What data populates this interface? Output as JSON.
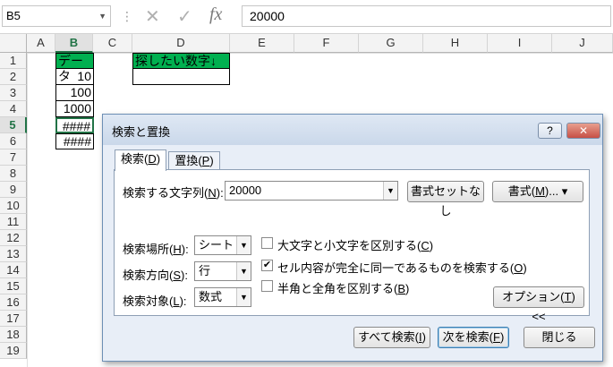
{
  "formula_bar": {
    "name_box": "B5",
    "fx_label": "fx",
    "formula_value": "20000"
  },
  "grid": {
    "columns": [
      "A",
      "B",
      "C",
      "D",
      "E",
      "F",
      "G",
      "H",
      "I",
      "J"
    ],
    "rows": [
      "1",
      "2",
      "3",
      "4",
      "5",
      "6",
      "7",
      "8",
      "9",
      "10",
      "11",
      "12",
      "13",
      "14",
      "15",
      "16",
      "17",
      "18",
      "19"
    ],
    "selected_column": "B",
    "selected_row": "5",
    "cells": {
      "B1": "データ",
      "B2": "10",
      "B3": "100",
      "B4": "1000",
      "B5": "####",
      "B6": "####",
      "D1": "探したい数字↓"
    },
    "header_fill": "#00b050"
  },
  "dialog": {
    "title": "検索と置換",
    "help_label": "?",
    "close_label": "✕",
    "tabs": [
      {
        "label": "検索",
        "key": "D",
        "active": true
      },
      {
        "label": "置換",
        "key": "P",
        "active": false
      }
    ],
    "find_label": "検索する文字列(",
    "find_key": "N",
    "find_label_end": "):",
    "find_value": "20000",
    "no_format_label": "書式セットなし",
    "format_label": "書式(",
    "format_key": "M",
    "format_label_end": ")...",
    "within_label": "検索場所(",
    "within_key": "H",
    "within_value": "シート",
    "search_label": "検索方向(",
    "search_key": "S",
    "search_value": "行",
    "lookin_label": "検索対象(",
    "lookin_key": "L",
    "lookin_value": "数式",
    "match_case_label": "大文字と小文字を区別する(",
    "match_case_key": "C",
    "match_case_checked": false,
    "match_entire_label": "セル内容が完全に同一であるものを検索する(",
    "match_entire_key": "O",
    "match_entire_checked": true,
    "match_byte_label": "半角と全角を区別する(",
    "match_byte_key": "B",
    "match_byte_checked": false,
    "options_label": "オプション(",
    "options_key": "T",
    "options_end": ") <<",
    "find_all_label": "すべて検索(",
    "find_all_key": "I",
    "find_next_label": "次を検索(",
    "find_next_key": "F",
    "close_button_label": "閉じる"
  }
}
